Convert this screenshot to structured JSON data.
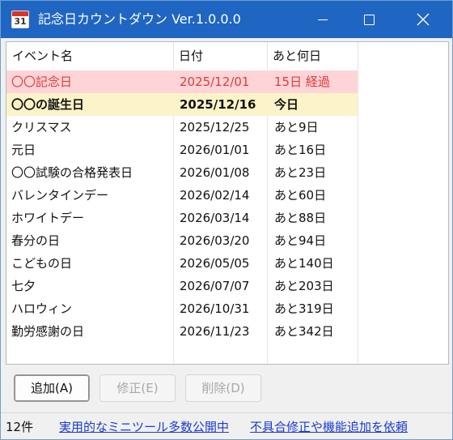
{
  "window": {
    "title": "記念日カウントダウン Ver.1.0.0.0",
    "icon_day": "31",
    "accent": "#1f66c2"
  },
  "columns": [
    "イベント名",
    "日付",
    "あと何日"
  ],
  "rows": [
    {
      "name": "〇〇記念日",
      "date": "2025/12/01",
      "days": "15日 経過",
      "state": "past"
    },
    {
      "name": "〇〇の誕生日",
      "date": "2025/12/16",
      "days": "今日",
      "state": "today"
    },
    {
      "name": "クリスマス",
      "date": "2025/12/25",
      "days": "あと9日",
      "state": "future"
    },
    {
      "name": "元日",
      "date": "2026/01/01",
      "days": "あと16日",
      "state": "future"
    },
    {
      "name": "〇〇試験の合格発表日",
      "date": "2026/01/08",
      "days": "あと23日",
      "state": "future"
    },
    {
      "name": "バレンタインデー",
      "date": "2026/02/14",
      "days": "あと60日",
      "state": "future"
    },
    {
      "name": "ホワイトデー",
      "date": "2026/03/14",
      "days": "あと88日",
      "state": "future"
    },
    {
      "name": "春分の日",
      "date": "2026/03/20",
      "days": "あと94日",
      "state": "future"
    },
    {
      "name": "こどもの日",
      "date": "2026/05/05",
      "days": "あと140日",
      "state": "future"
    },
    {
      "name": "七夕",
      "date": "2026/07/07",
      "days": "あと203日",
      "state": "future"
    },
    {
      "name": "ハロウィン",
      "date": "2026/10/31",
      "days": "あと319日",
      "state": "future"
    },
    {
      "name": "勤労感謝の日",
      "date": "2026/11/23",
      "days": "あと342日",
      "state": "future"
    }
  ],
  "buttons": {
    "add": "追加(A)",
    "edit": "修正(E)",
    "delete": "削除(D)"
  },
  "status": {
    "count": "12件",
    "link1": "実用的なミニツール多数公開中",
    "link2": "不具合修正や機能追加を依頼"
  },
  "colors": {
    "past_bg": "#fdd5d8",
    "past_text": "#e33838",
    "today_bg": "#fdf3c8",
    "link": "#1a3cd0"
  }
}
